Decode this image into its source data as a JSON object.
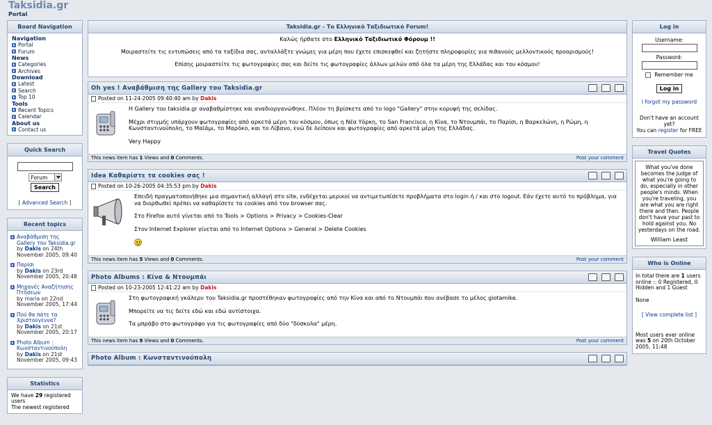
{
  "header": {
    "title": "Taksidia.gr",
    "subtitle": "Portal"
  },
  "board_nav": {
    "title": "Board Navigation",
    "groups": [
      {
        "label": "Navigation",
        "items": [
          "Portal",
          "Forum"
        ]
      },
      {
        "label": "News",
        "items": [
          "Categories",
          "Archives"
        ]
      },
      {
        "label": "Download",
        "items": [
          "Latest",
          "Search",
          "Top 10"
        ]
      },
      {
        "label": "Tools",
        "items": [
          "Recent Topics",
          "Calendar"
        ]
      },
      {
        "label": "About us",
        "items": [
          "Contact us"
        ]
      }
    ]
  },
  "quick_search": {
    "title": "Quick Search",
    "select_value": "Forum",
    "button": "Search",
    "advanced": "Advanced Search"
  },
  "recent_topics": {
    "title": "Recent topics",
    "items": [
      {
        "topic": "Αναβάθμιση της Gallery του Taksidia.gr",
        "by": "by",
        "author": "Dakis",
        "date_a": "on 24th",
        "date_b": "November 2005, 09:40",
        "author_red": true
      },
      {
        "topic": "Παρίσι",
        "by": "by",
        "author": "Dakis",
        "date_a": "on 23rd",
        "date_b": "November 2005, 20:48",
        "author_red": true
      },
      {
        "topic": "Μηχανές Αναζήτησης Πτήσεων",
        "by": "by",
        "author": "maria",
        "date_a": "on 22nd",
        "date_b": "November 2005, 17:44",
        "author_red": false
      },
      {
        "topic": "Πού θα πάτε τα Χριστούγεννα?",
        "by": "by",
        "author": "Dakis",
        "date_a": "on 21st",
        "date_b": "November 2005, 20:17",
        "author_red": true
      },
      {
        "topic": "Photo Album : Κωνσταντινούπολη",
        "by": "by",
        "author": "Dakis",
        "date_a": "on 21st",
        "date_b": "November 2005, 09:43",
        "author_red": true
      }
    ]
  },
  "statistics": {
    "title": "Statistics",
    "line1a": "We have",
    "line1b": "29",
    "line1c": "registered users",
    "line2": "The newest registered"
  },
  "welcome": {
    "title": "Taksidia.gr - Το Ελληνικό Ταξιδιωτικό Forum!",
    "p1a": "Καλώς ήρθατε στο",
    "p1b": "Ελληνικό Ταξιδιωτικό Φόρουμ !!",
    "p2": "Μοιραστείτε τις εντυπώσεις από τα ταξίδια σας, ανταλλάξτε γνώμες για μέρη που έχετε επισκεφθεί και ζητήστε πληροφορίες για πιθανούς μελλοντικούς προορισμούς!",
    "p3": "Επίσης μοιραστείτε τις φωτογραφίες σας και δείτε τις φωτογραφίες άλλων μελών από όλα τα μέρη της Ελλάδας και του κόσμου!"
  },
  "news": [
    {
      "title": "Oh yes !  Αναβάθμιση της Gallery του Taksidia.gr",
      "posted": "Posted on 11-24-2005 09:40:40 am by",
      "author": "Dakis",
      "paras": [
        "Η Gallery του taksidia.gr αναβαθμίστηκε και αναδιοργανώθηκε. Πλέον τη βρίσκετε από το logo \"Gallery\" στην κορυφή της σελίδας.",
        "Μέχρι στιγμής υπάρχουν φωτογραφίες από αρκετά μέρη του κόσμου, όπως η Νέα Υόρκη, το San Francisco, η Κίνα, το Ντουμπάι, το Παρίσι, η Βαρκελώνη, η Ρώμη, η Κωνσταντινούπολη, το Μαϊάμι, το Μαρόκο, και το Λίβανο, ενώ δε λείπουν και φωτογραφίες από αρκετά μέρη της Ελλάδας.",
        "Very Happy"
      ],
      "foot_a": "This news item has",
      "views": "1",
      "foot_b": "Views and",
      "comments": "0",
      "foot_c": "Comments.",
      "post_comment": "Post your comment",
      "image": "phone-icon"
    },
    {
      "title": "Idea  Καθαρίστε τα cookies σας !",
      "posted": "Posted on 10-26-2005 04:35:53 pm by",
      "author": "Dakis",
      "paras": [
        "Επειδή πραγματοποιήθηκε μια σημαντική αλλαγή στο site, ενδέχεται μερικοί να αντιμετωπίσετε προβλήματα στο login ή / και στο logout. Εάν έχετε αυτό το πρόβλημα, για να διορθωθεί πρέπει να καθαρίσετε τα cookies από τον browser σας.",
        "Στο Firefox αυτό γίνεται από το Tools > Options > Privacy > Cookies-Clear",
        "Στον Internet Explorer γίνεται από το Internet Options > General > Delete Cookies"
      ],
      "foot_a": "This news item has",
      "views": "5",
      "foot_b": "Views and",
      "comments": "0",
      "foot_c": "Comments.",
      "post_comment": "Post your comment",
      "image": "megaphone-icon"
    },
    {
      "title": "Photo Albums : Κίνα & Ντουμπάι",
      "posted": "Posted on 10-23-2005 12:41:22 am by",
      "author": "Dakis",
      "paras": [
        "Στη φωτογραφική γκάλερυ του Taksidia.gr προστέθηκαν φωτογραφίες από την Κίνα και από το Ντουμπάι που ανέβασε το μέλος giotamike.",
        "Μπορείτε να τις δείτε εδώ και εδώ αντίστοιχα.",
        "Τα μπράβο στο φωτογράφο για τις φωτογραφίες από δύο \"δύσκολα\" μέρη."
      ],
      "foot_a": "This news item has",
      "views": "9",
      "foot_b": "Views and",
      "comments": "0",
      "foot_c": "Comments.",
      "post_comment": "Post your comment",
      "image": "phone-icon"
    },
    {
      "title": "Photo Album : Κωνσταντινούπολη"
    }
  ],
  "login": {
    "title": "Log in",
    "username": "Username:",
    "password": "Password:",
    "remember": "Remember me",
    "button": "Log in",
    "forgot": "I forgot my password",
    "no_account": "Don't have an account yet?",
    "register_a": "You can",
    "register_link": "register",
    "register_b": "for FREE"
  },
  "travel_quotes": {
    "title": "Travel Quotes",
    "quote": "What you've done becomes the judge of what you're going to do, especially in other people's minds. When you're traveling, you are what you are right there and then. People don't have your past to hold against you. No yesterdays on the road.",
    "author": "William Least"
  },
  "who_online": {
    "title": "Who is Online",
    "line1a": "In total there are",
    "line1b": "1",
    "line1c": "users online :: 0 Registered, 0 Hidden and 1 Guest",
    "none": "None",
    "view_list": "[ View complete list ]",
    "most_a": "Most users ever online was",
    "most_b": "5",
    "most_c": "on 20th October 2005, 11:48"
  }
}
